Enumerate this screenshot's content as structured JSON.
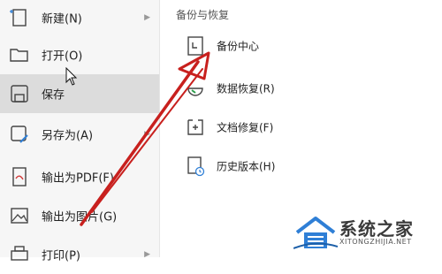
{
  "left_menu": {
    "items": [
      {
        "label": "新建(N)",
        "icon": "new-file-icon",
        "has_submenu": true
      },
      {
        "label": "打开(O)",
        "icon": "folder-open-icon",
        "has_submenu": false
      },
      {
        "label": "保存",
        "icon": "save-icon",
        "has_submenu": false
      },
      {
        "label": "另存为(A)",
        "icon": "save-as-icon",
        "has_submenu": true
      },
      {
        "label": "输出为PDF(F)",
        "icon": "export-pdf-icon",
        "has_submenu": false
      },
      {
        "label": "输出为图片(G)",
        "icon": "export-image-icon",
        "has_submenu": false
      },
      {
        "label": "打印(P)",
        "icon": "print-icon",
        "has_submenu": true
      }
    ]
  },
  "right_panel": {
    "title": "备份与恢复",
    "items": [
      {
        "label": "备份中心",
        "icon": "backup-center-icon"
      },
      {
        "label": "数据恢复(R)",
        "icon": "data-recovery-icon"
      },
      {
        "label": "文档修复(F)",
        "icon": "document-repair-icon"
      },
      {
        "label": "历史版本(H)",
        "icon": "history-version-icon"
      }
    ]
  },
  "watermark": {
    "title": "系统之家",
    "subtitle": "XITONGZHIJIA.NET"
  },
  "colors": {
    "active_bg": "#dcdcdc",
    "menu_bg": "#f6f6f6",
    "annotation_red": "#c8201e",
    "watermark_blue": "#2f7fd6"
  }
}
